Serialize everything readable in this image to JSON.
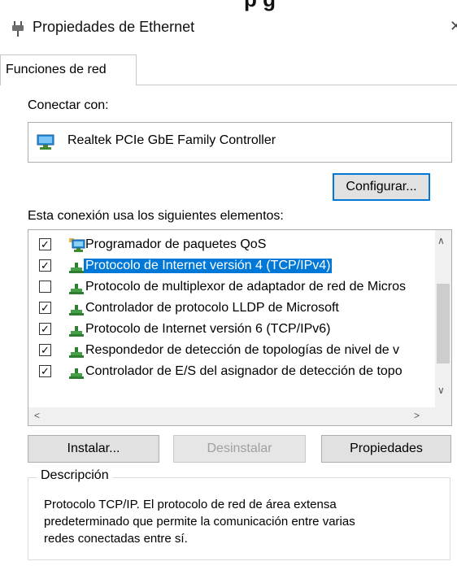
{
  "window": {
    "title": "Propiedades de Ethernet",
    "close_glyph": "✕",
    "cut_top_text": "p          g"
  },
  "tabs": [
    {
      "label": "Funciones de red",
      "active": true
    }
  ],
  "connect": {
    "label": "Conectar con:",
    "adapter": "Realtek PCIe GbE Family Controller",
    "adapter_icon": "network-adapter-icon",
    "configure_button": "Configurar..."
  },
  "items_section": {
    "label": "Esta conexión usa los siguientes elementos:",
    "items": [
      {
        "checked": true,
        "label": "Programador de paquetes QoS",
        "icon": "network-service-icon",
        "selected": false
      },
      {
        "checked": true,
        "label": "Protocolo de Internet versión 4 (TCP/IPv4)",
        "icon": "protocol-icon",
        "selected": true
      },
      {
        "checked": false,
        "label": "Protocolo de multiplexor de adaptador de red de Micros",
        "icon": "protocol-icon",
        "selected": false
      },
      {
        "checked": true,
        "label": "Controlador de protocolo LLDP de Microsoft",
        "icon": "protocol-icon",
        "selected": false
      },
      {
        "checked": true,
        "label": "Protocolo de Internet versión 6 (TCP/IPv6)",
        "icon": "protocol-icon",
        "selected": false
      },
      {
        "checked": true,
        "label": "Respondedor de detección de topologías de nivel de v",
        "icon": "protocol-icon",
        "selected": false
      },
      {
        "checked": true,
        "label": "Controlador de E/S del asignador de detección de topo",
        "icon": "protocol-icon",
        "selected": false
      }
    ],
    "scroll": {
      "up": "∧",
      "down": "∨",
      "left": "<",
      "right": ">"
    }
  },
  "buttons": {
    "install": "Instalar...",
    "uninstall": "Desinstalar",
    "properties": "Propiedades"
  },
  "description": {
    "legend": "Descripción",
    "lines": [
      "Protocolo TCP/IP. El protocolo de red de área extensa",
      "predeterminado que permite la comunicación entre varias",
      "redes conectadas entre sí."
    ]
  },
  "colors": {
    "selection": "#0078d7",
    "button_face": "#e1e1e1",
    "border": "#adadad"
  }
}
